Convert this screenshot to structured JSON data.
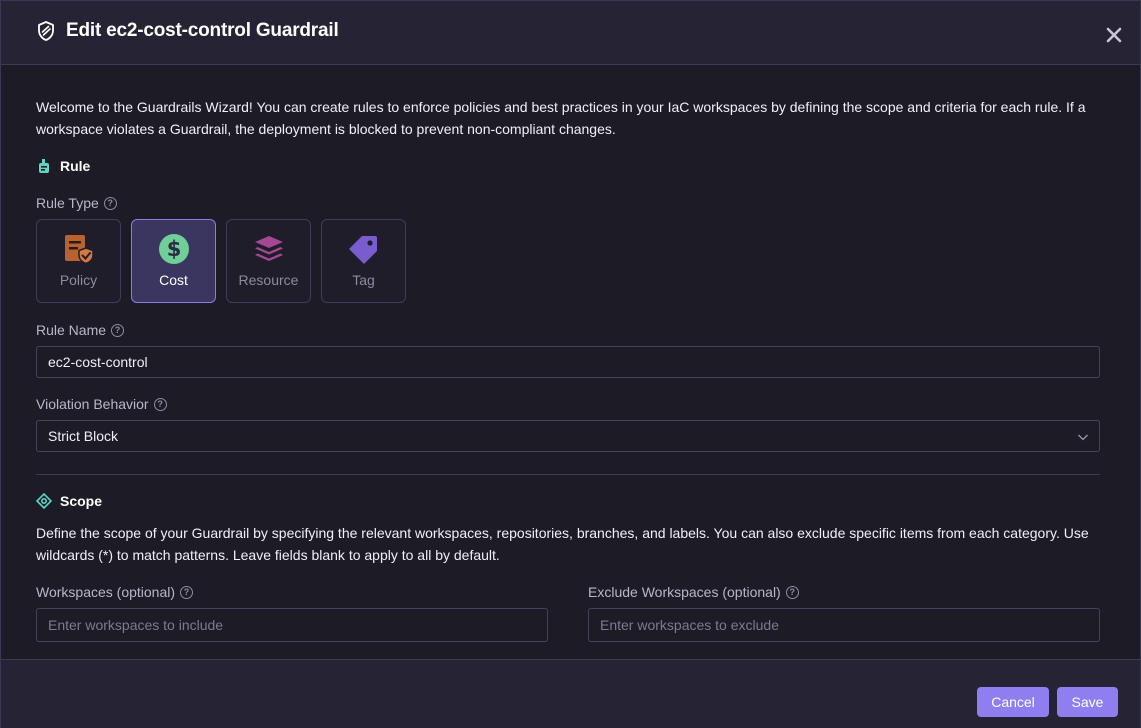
{
  "dialog": {
    "title": "Edit ec2-cost-control Guardrail"
  },
  "intro": "Welcome to the Guardrails Wizard! You can create rules to enforce policies and best practices in your IaC workspaces by defining the scope and criteria for each rule. If a workspace violates a Guardrail, the deployment is blocked to prevent non-compliant changes.",
  "rule": {
    "heading": "Rule",
    "rule_type_label": "Rule Type",
    "types": [
      {
        "label": "Policy",
        "selected": false,
        "color": "#c0693a"
      },
      {
        "label": "Cost",
        "selected": true,
        "color": "#6fcf97"
      },
      {
        "label": "Resource",
        "selected": false,
        "color": "#a54793"
      },
      {
        "label": "Tag",
        "selected": false,
        "color": "#7a5ccf"
      }
    ],
    "rule_name_label": "Rule Name",
    "rule_name_value": "ec2-cost-control",
    "violation_label": "Violation Behavior",
    "violation_value": "Strict Block"
  },
  "scope": {
    "heading": "Scope",
    "description": "Define the scope of your Guardrail by specifying the relevant workspaces, repositories, branches, and labels. You can also exclude specific items from each category. Use wildcards (*) to match patterns. Leave fields blank to apply to all by default.",
    "workspaces_label": "Workspaces (optional)",
    "workspaces_placeholder": "Enter workspaces to include",
    "exclude_label": "Exclude Workspaces (optional)",
    "exclude_placeholder": "Enter workspaces to exclude"
  },
  "footer": {
    "cancel_label": "Cancel",
    "save_label": "Save"
  },
  "colors": {
    "accent": "#8f7ef0",
    "section_icon": "#5fd4c4"
  }
}
